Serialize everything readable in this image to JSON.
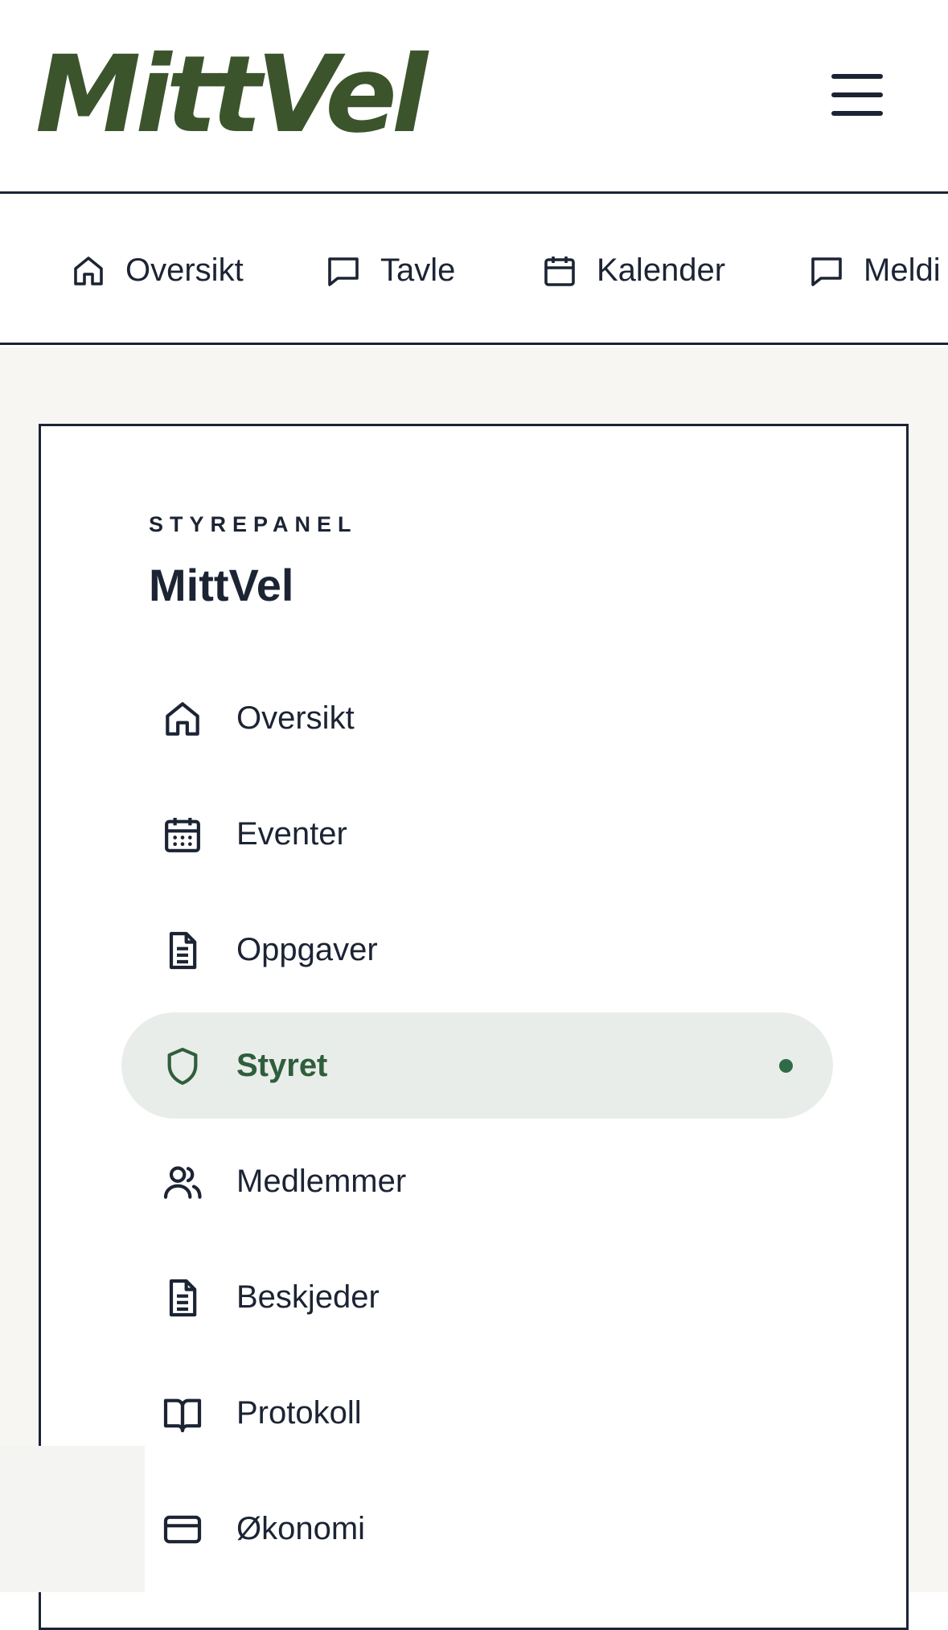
{
  "header": {
    "logo_text": "MittVel",
    "menu_icon": "hamburger-menu-icon",
    "brand_color": "#3c542c"
  },
  "topnav": {
    "items": [
      {
        "label": "Oversikt",
        "icon": "home-icon"
      },
      {
        "label": "Tavle",
        "icon": "message-square-icon"
      },
      {
        "label": "Kalender",
        "icon": "calendar-icon"
      },
      {
        "label": "Meldi",
        "icon": "message-square-icon"
      }
    ]
  },
  "panel": {
    "eyebrow": "STYREPANEL",
    "title": "MittVel",
    "items": [
      {
        "label": "Oversikt",
        "icon": "home-icon",
        "active": false
      },
      {
        "label": "Eventer",
        "icon": "calendar-days-icon",
        "active": false
      },
      {
        "label": "Oppgaver",
        "icon": "document-icon",
        "active": false
      },
      {
        "label": "Styret",
        "icon": "shield-icon",
        "active": true
      },
      {
        "label": "Medlemmer",
        "icon": "users-icon",
        "active": false
      },
      {
        "label": "Beskjeder",
        "icon": "document-icon",
        "active": false
      },
      {
        "label": "Protokoll",
        "icon": "book-open-icon",
        "active": false
      },
      {
        "label": "Økonomi",
        "icon": "credit-card-icon",
        "active": false
      }
    ],
    "active_color": "#2f5e3c",
    "active_bg": "#e9ede9"
  }
}
